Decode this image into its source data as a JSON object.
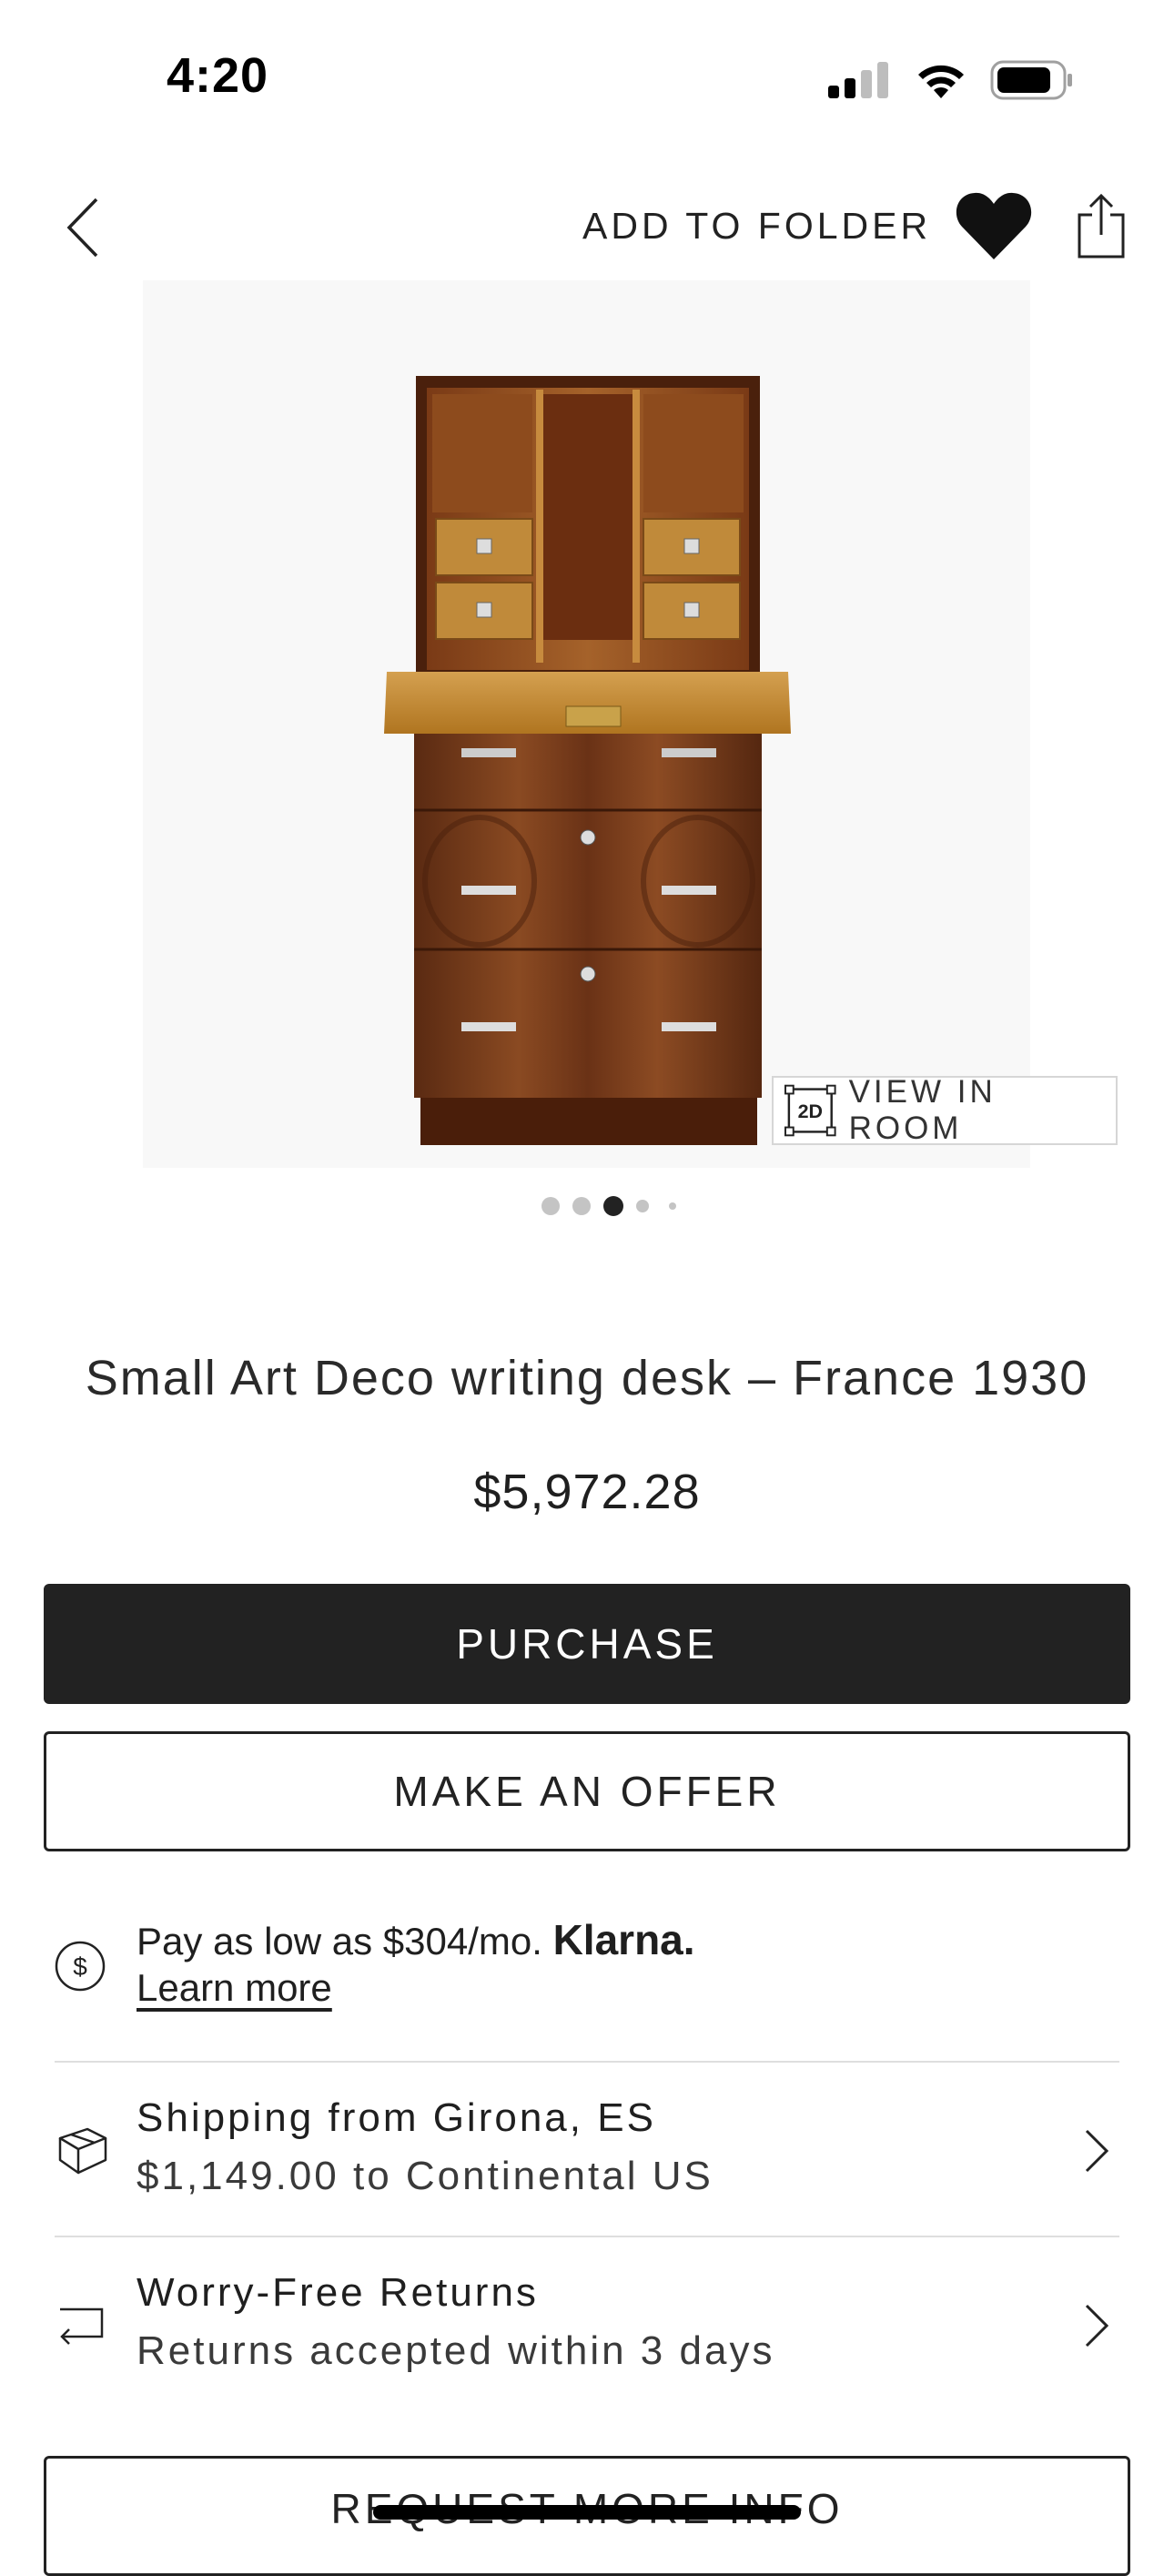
{
  "status_bar": {
    "time": "4:20"
  },
  "header": {
    "add_to_folder": "ADD TO FOLDER"
  },
  "gallery": {
    "view_in_room": "VIEW IN ROOM",
    "badge": "2D",
    "total_images": 5,
    "active_index": 3
  },
  "product": {
    "title": "Small Art Deco writing desk – France 1930",
    "price": "$5,972.28"
  },
  "actions": {
    "purchase": "PURCHASE",
    "make_offer": "MAKE AN OFFER",
    "request_info": "REQUEST MORE INFO"
  },
  "klarna": {
    "icon": "dollar-circle-icon",
    "text": "Pay as low as $304/mo.",
    "brand": "Klarna.",
    "learn_more": "Learn more"
  },
  "shipping": {
    "icon": "box-icon",
    "title": "Shipping from Girona, ES",
    "detail": "$1,149.00 to Continental US"
  },
  "returns": {
    "icon": "return-arrow-icon",
    "title": "Worry-Free Returns",
    "detail": "Returns accepted within 3 days"
  },
  "colors": {
    "primary": "#222222",
    "divider": "#dedede"
  }
}
